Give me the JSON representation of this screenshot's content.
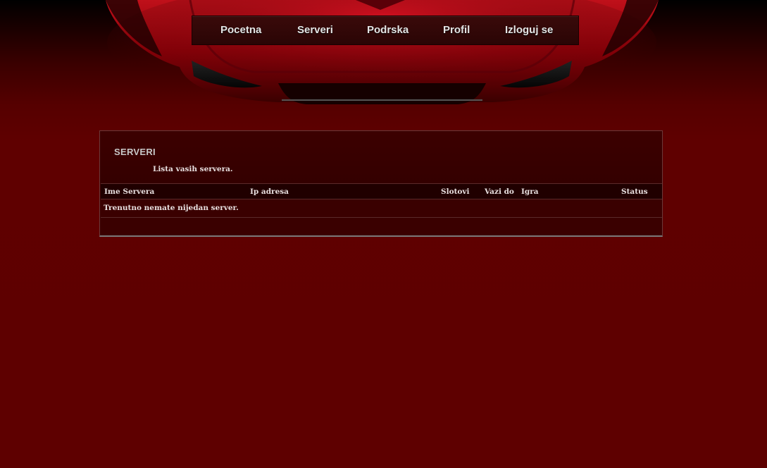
{
  "nav": {
    "items": [
      {
        "label": "Pocetna"
      },
      {
        "label": "Serveri"
      },
      {
        "label": "Podrska"
      },
      {
        "label": "Profil"
      },
      {
        "label": "Izloguj se"
      }
    ]
  },
  "panel": {
    "title": "SERVERI",
    "subtitle": "Lista vasih servera."
  },
  "table": {
    "columns": [
      "Ime Servera",
      "Ip adresa",
      "Slotovi",
      "Vazi do",
      "Igra",
      "Status"
    ],
    "empty_message": "Trenutno nemate nijedan server."
  },
  "colors": {
    "background": "#5e0000",
    "panel": "#3a0000",
    "header_row": "#200000",
    "text": "#e8e0e0"
  }
}
